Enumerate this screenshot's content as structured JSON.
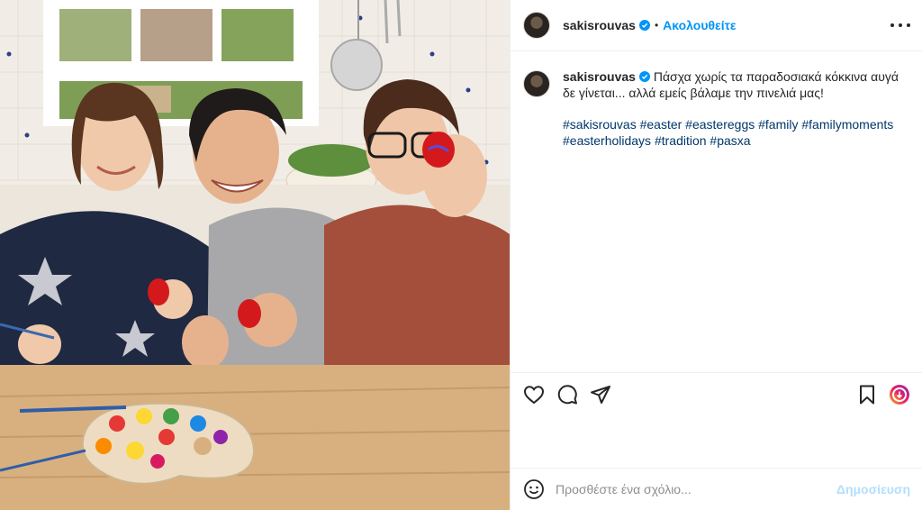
{
  "post": {
    "username": "sakisrouvas",
    "follow_status": "Ακολουθείτε",
    "separator": "•",
    "caption": "Πάσχα χωρίς τα παραδοσιακά κόκκινα αυγά δε γίνεται... αλλά εμείς βάλαμε την πινελιά μας!",
    "hashtags": "#sakisrouvas #easter #eastereggs #family #familymoments #easterholidays #tradition #pasxa",
    "verified": true
  },
  "comment": {
    "placeholder": "Προσθέστε ένα σχόλιο...",
    "publish_label": "Δημοσίευση"
  },
  "icons": {
    "more": "more-options-icon",
    "like": "heart-icon",
    "comment": "comment-icon",
    "share": "paper-plane-icon",
    "save": "bookmark-icon",
    "emoji": "smiley-icon"
  },
  "colors": {
    "link": "#0095f6",
    "hashtag": "#00376b",
    "border": "#efefef",
    "publish_disabled": "#b2dffc"
  }
}
